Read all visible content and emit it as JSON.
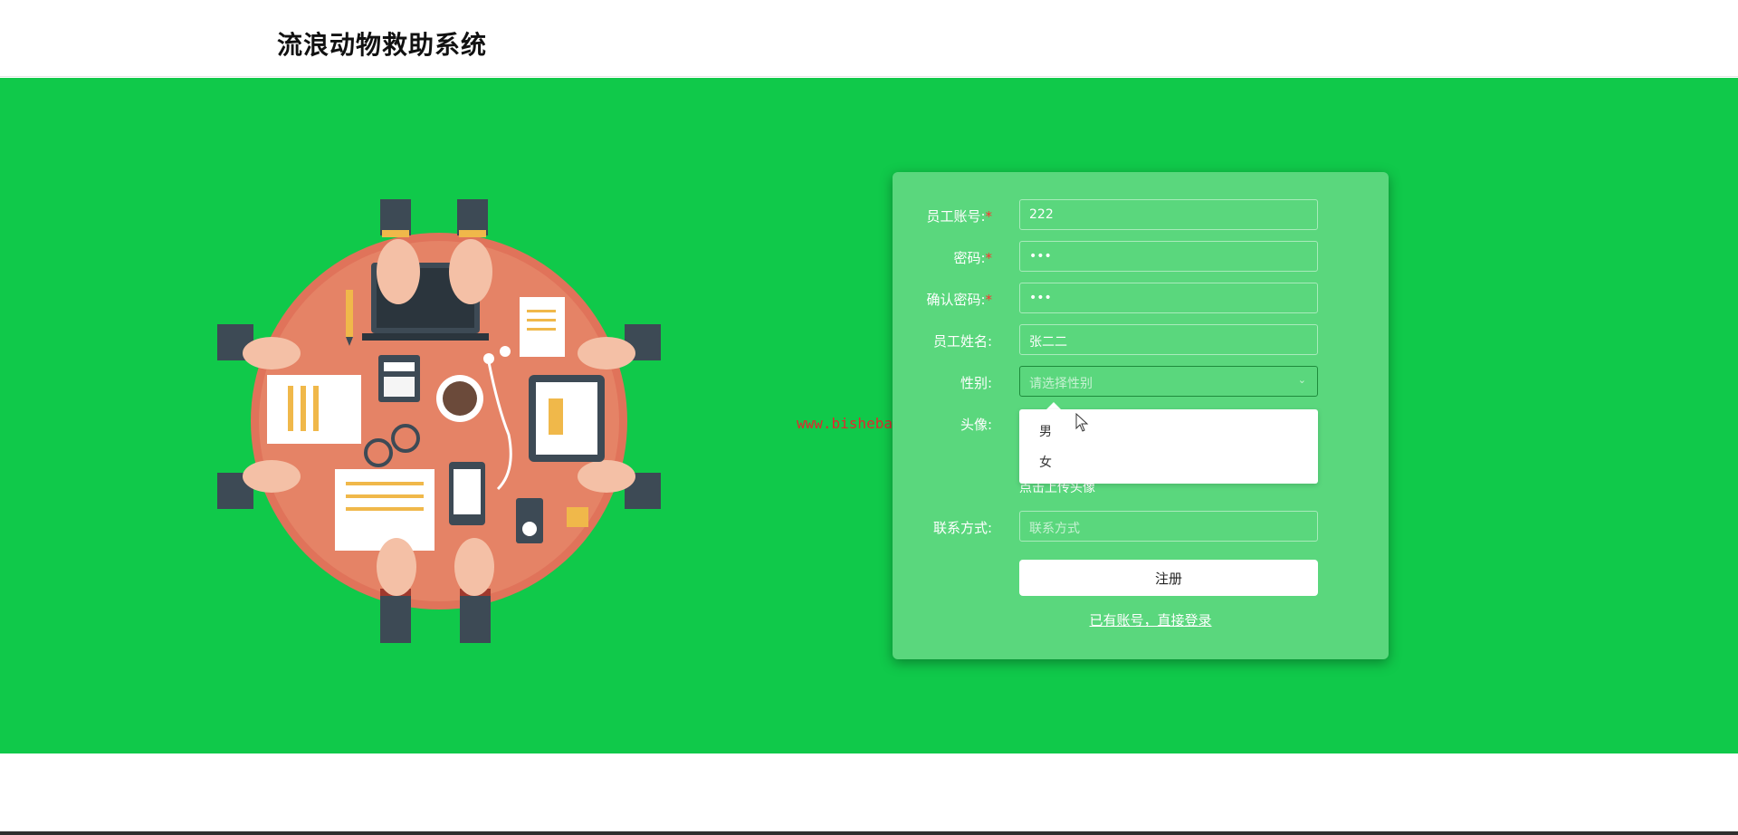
{
  "header": {
    "title": "流浪动物救助系统"
  },
  "watermark": "www.bishebang.site",
  "form": {
    "fields": [
      {
        "label": "员工账号:",
        "required": true,
        "value": "222",
        "placeholder": ""
      },
      {
        "label": "密码:",
        "required": true,
        "value": "•••",
        "placeholder": ""
      },
      {
        "label": "确认密码:",
        "required": true,
        "value": "•••",
        "placeholder": ""
      },
      {
        "label": "员工姓名:",
        "required": false,
        "value": "张二二",
        "placeholder": ""
      },
      {
        "label": "性别:",
        "required": false,
        "value": "",
        "placeholder": "请选择性别"
      },
      {
        "label": "头像:",
        "required": false,
        "value": "",
        "placeholder": ""
      },
      {
        "label": "联系方式:",
        "required": false,
        "value": "",
        "placeholder": "联系方式"
      }
    ],
    "required_mark": "*",
    "gender_options": [
      "男",
      "女"
    ],
    "avatar_upload_text": "点击上传头像",
    "register_label": "注册",
    "login_link": "已有账号，直接登录"
  },
  "colors": {
    "hero_background": "#10c94a",
    "panel_background": "#5ad77d",
    "required_mark": "#ff3030",
    "watermark": "#e3262f"
  },
  "icons": {
    "select_chevron": "chevron-down-icon",
    "cursor": "mouse-pointer-icon"
  }
}
